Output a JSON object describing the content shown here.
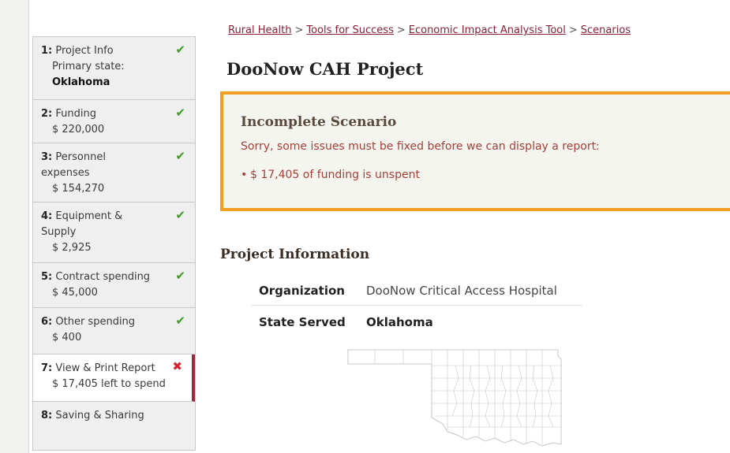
{
  "breadcrumb": {
    "items": [
      "Rural Health",
      "Tools for Success",
      "Economic Impact Analysis Tool",
      "Scenarios"
    ],
    "separator": ">"
  },
  "page": {
    "title": "DooNow CAH Project"
  },
  "steps": [
    {
      "num": "1:",
      "label": "Project Info",
      "lines": [
        "Primary state:",
        "Oklahoma"
      ],
      "status": "complete"
    },
    {
      "num": "2:",
      "label": "Funding",
      "lines": [
        "$ 220,000"
      ],
      "status": "complete"
    },
    {
      "num": "3:",
      "label": "Personnel",
      "lines": [
        "expenses",
        "$ 154,270"
      ],
      "status": "complete"
    },
    {
      "num": "4:",
      "label": "Equipment &",
      "lines": [
        "Supply",
        "$ 2,925"
      ],
      "status": "complete"
    },
    {
      "num": "5:",
      "label": "Contract spending",
      "lines": [
        "$ 45,000"
      ],
      "status": "complete"
    },
    {
      "num": "6:",
      "label": "Other spending",
      "lines": [
        "$ 400"
      ],
      "status": "complete"
    },
    {
      "num": "7:",
      "label": "View & Print Report",
      "lines": [
        "$ 17,405 left to spend"
      ],
      "status": "incomplete"
    },
    {
      "num": "8:",
      "label": "Saving & Sharing",
      "lines": [],
      "status": "none"
    }
  ],
  "alert": {
    "title": "Incomplete Scenario",
    "message": "Sorry, some issues must be fixed before we can display a report:",
    "issues": [
      "$ 17,405 of funding is unspent"
    ]
  },
  "project_info": {
    "heading": "Project Information",
    "organization_label": "Organization",
    "organization_value": "DooNow Critical Access Hospital",
    "state_label": "State Served",
    "state_value": "Oklahoma"
  },
  "icons": {
    "complete": "check-icon",
    "incomplete": "x-icon",
    "map": "oklahoma-county-map"
  },
  "colors": {
    "link": "#8a1f35",
    "alert_border": "#f2a024",
    "alert_text": "#a63f3a",
    "check": "#3f9b24",
    "cross": "#d9202c",
    "active_step_bar": "#a0283c"
  }
}
